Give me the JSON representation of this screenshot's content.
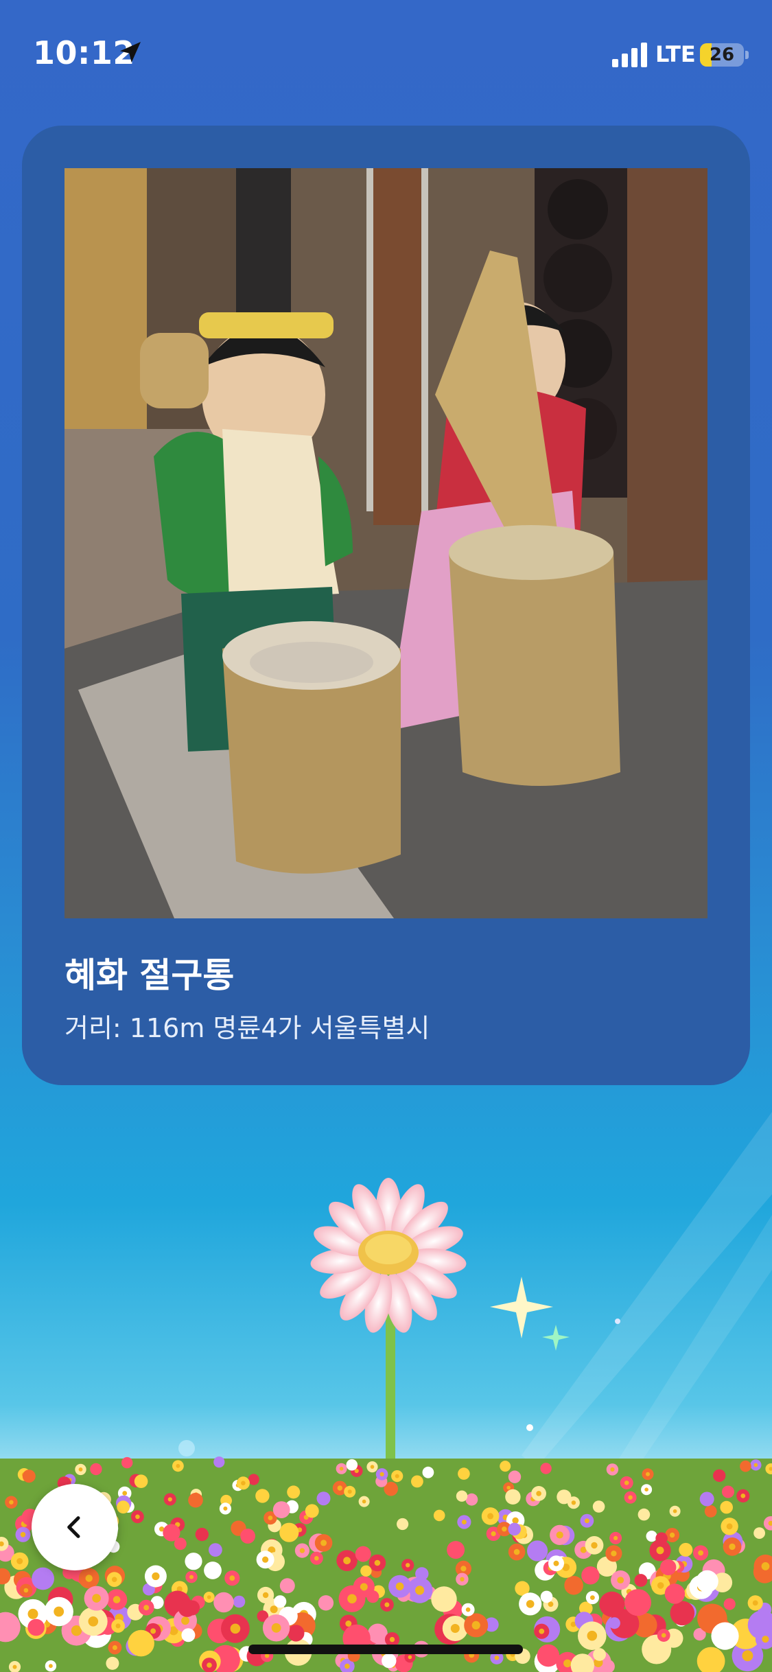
{
  "status_bar": {
    "time": "10:12",
    "network": "LTE",
    "battery_level": "26",
    "battery_fraction": 0.26
  },
  "place": {
    "name": "혜화 절구통",
    "subtitle": "거리: 116m 명륜4가 서울특별시"
  },
  "icons": {
    "location": "location-arrow-icon",
    "back": "chevron-left-icon"
  },
  "colors": {
    "background_top": "#3468c8",
    "card": "#2c5da6",
    "battery": "#f5d32b"
  }
}
